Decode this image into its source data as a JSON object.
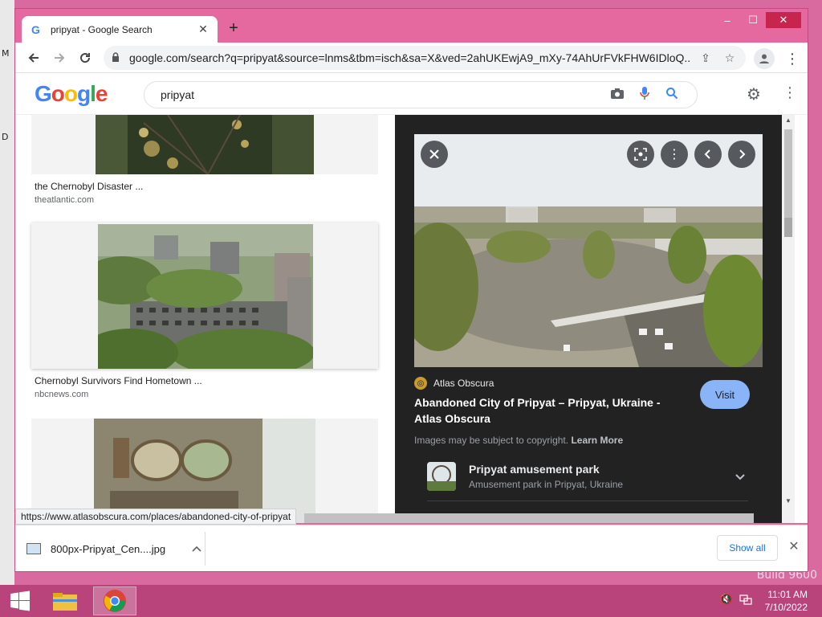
{
  "browser": {
    "tab_title": "pripyat - Google Search",
    "tab_favicon": "G",
    "url": "google.com/search?q=pripyat&source=lnms&tbm=isch&sa=X&ved=2ahUKEwjA9_mXy-74AhUrFVkFHW6IDloQ...",
    "window_controls": {
      "minimize": "–",
      "maximize": "☐",
      "close": "✕"
    }
  },
  "google": {
    "logo": "Google",
    "query": "pripyat"
  },
  "results": [
    {
      "title": "the Chernobyl Disaster ...",
      "source": "theatlantic.com"
    },
    {
      "title": "Chernobyl Survivors Find Hometown ...",
      "source": "nbcnews.com"
    }
  ],
  "preview": {
    "source_name": "Atlas Obscura",
    "title": "Abandoned City of Pripyat – Pripyat, Ukraine - Atlas Obscura",
    "visit_label": "Visit",
    "copyright_text": "Images may be subject to copyright.",
    "learn_more_label": "Learn More",
    "entity_title": "Pripyat amusement park",
    "entity_subtitle": "Amusement park in Pripyat, Ukraine"
  },
  "status_url": "https://www.atlasobscura.com/places/abandoned-city-of-pripyat",
  "download": {
    "filename": "800px-Pripyat_Cen....jpg",
    "show_all_label": "Show all"
  },
  "taskbar": {
    "time": "11:01 AM",
    "date": "7/10/2022"
  },
  "desktop": {
    "build_text": "Build 9600"
  }
}
